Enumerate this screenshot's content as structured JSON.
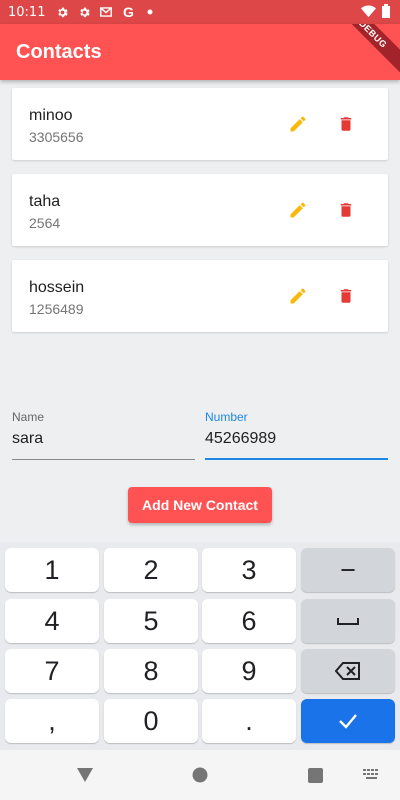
{
  "status_bar": {
    "time": "10:11"
  },
  "app_bar": {
    "title": "Contacts",
    "debug_label": "DEBUG"
  },
  "contacts": [
    {
      "name": "minoo",
      "number": "3305656"
    },
    {
      "name": "taha",
      "number": "2564"
    },
    {
      "name": "hossein",
      "number": "1256489"
    }
  ],
  "form": {
    "name_label": "Name",
    "name_value": "sara",
    "number_label": "Number",
    "number_value": "45266989",
    "add_button_label": "Add New Contact"
  },
  "keyboard": {
    "rows": [
      [
        "1",
        "2",
        "3",
        "−"
      ],
      [
        "4",
        "5",
        "6",
        "space"
      ],
      [
        "7",
        "8",
        "9",
        "backspace"
      ],
      [
        ",",
        "0",
        ".",
        "done"
      ]
    ]
  },
  "colors": {
    "app_bar": "#ff5252",
    "status_bar": "#dd4747",
    "edit_icon": "#f9b90b",
    "delete_icon": "#e53935",
    "focus": "#1e88e5",
    "keyboard_action": "#1a73e8"
  }
}
